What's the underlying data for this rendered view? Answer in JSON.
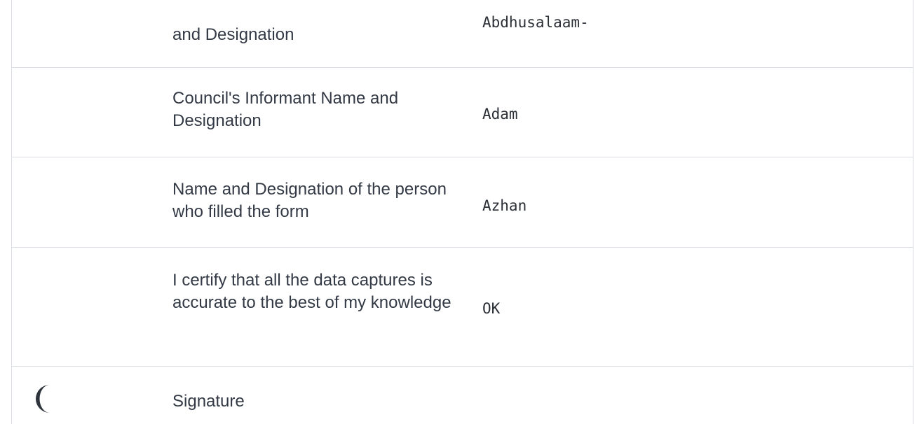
{
  "rows": [
    {
      "label": "and Designation",
      "value": "Abdhusalaam-"
    },
    {
      "label": "Council's Informant Name and Designation",
      "value": "Adam"
    },
    {
      "label": "Name and Designation of the person who filled the form",
      "value": "Azhan"
    },
    {
      "label": "I certify that all the data captures is accurate to the best of my knowledge",
      "value": "OK"
    },
    {
      "label": "Signature",
      "value": ""
    }
  ],
  "icons": {
    "theme_toggle": "moon-icon"
  },
  "colors": {
    "text": "#333a45",
    "border": "#dadde2",
    "icon": "#2e343c"
  }
}
